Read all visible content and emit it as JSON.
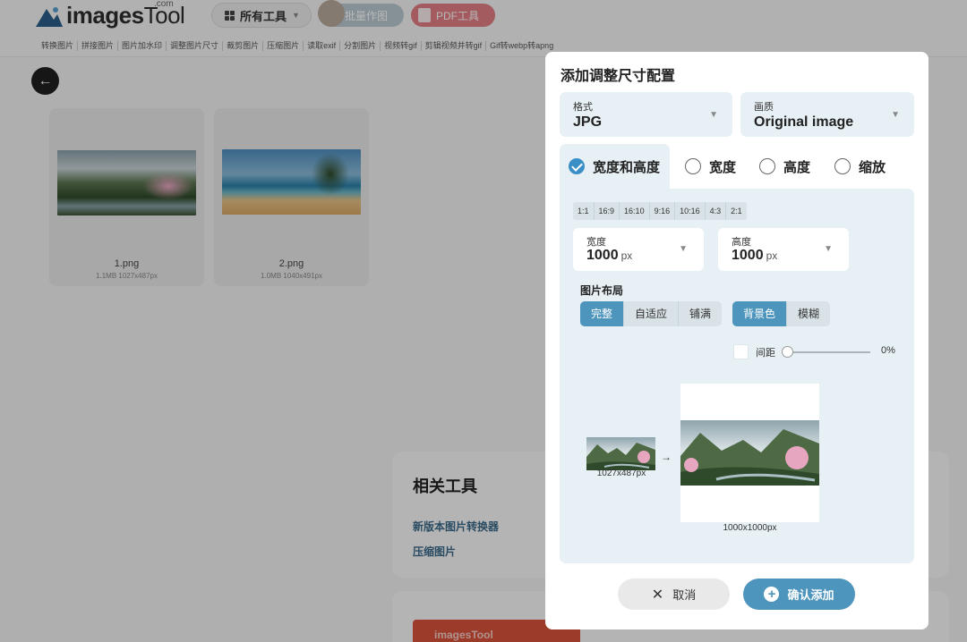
{
  "header": {
    "logo_text": "images",
    "logo_text_tail": "Tool",
    "logo_com": ".com",
    "all_tools": "所有工具",
    "batch_label": "批量作图",
    "pdf_label": "PDF工具"
  },
  "tool_links": [
    "转换图片",
    "拼接图片",
    "图片加水印",
    "调整图片尺寸",
    "裁剪图片",
    "压缩图片",
    "读取exif",
    "分割图片",
    "视频转gif",
    "剪辑视频并转gif",
    "Gif转webp转apng"
  ],
  "files": [
    {
      "name": "1.png",
      "meta": "1.1MB   1027x487px"
    },
    {
      "name": "2.png",
      "meta": "1.0MB   1040x491px"
    }
  ],
  "related": {
    "title": "相关工具",
    "links": [
      "新版本图片转换器",
      "压缩图片"
    ]
  },
  "promo_text": "imagesTool",
  "modal": {
    "title": "添加调整尺寸配置",
    "format": {
      "label": "格式",
      "value": "JPG"
    },
    "quality": {
      "label": "画质",
      "value": "Original image"
    },
    "tabs": [
      {
        "label": "宽度和高度",
        "selected": true
      },
      {
        "label": "宽度",
        "selected": false
      },
      {
        "label": "高度",
        "selected": false
      },
      {
        "label": "缩放",
        "selected": false
      }
    ],
    "ratios": [
      "1:1",
      "16:9",
      "16:10",
      "9:16",
      "10:16",
      "4:3",
      "2:1"
    ],
    "width": {
      "label": "宽度",
      "value": "1000",
      "unit": "px"
    },
    "height": {
      "label": "高度",
      "value": "1000",
      "unit": "px"
    },
    "layout_label": "图片布局",
    "layout_options": [
      "完整",
      "自适应",
      "铺满"
    ],
    "layout_selected": "完整",
    "fill_options": [
      "背景色",
      "模糊"
    ],
    "fill_selected": "背景色",
    "spacing": {
      "label": "间距",
      "value": "0%",
      "checked": false
    },
    "preview": {
      "source_size": "1027x487px",
      "target_size": "1000x1000px",
      "arrow": "→"
    },
    "cancel_label": "取消",
    "confirm_label": "确认添加"
  },
  "colors": {
    "accent": "#4e95bd",
    "panel_bg": "#e7f0f4",
    "radio_on": "#3a8fc6"
  }
}
